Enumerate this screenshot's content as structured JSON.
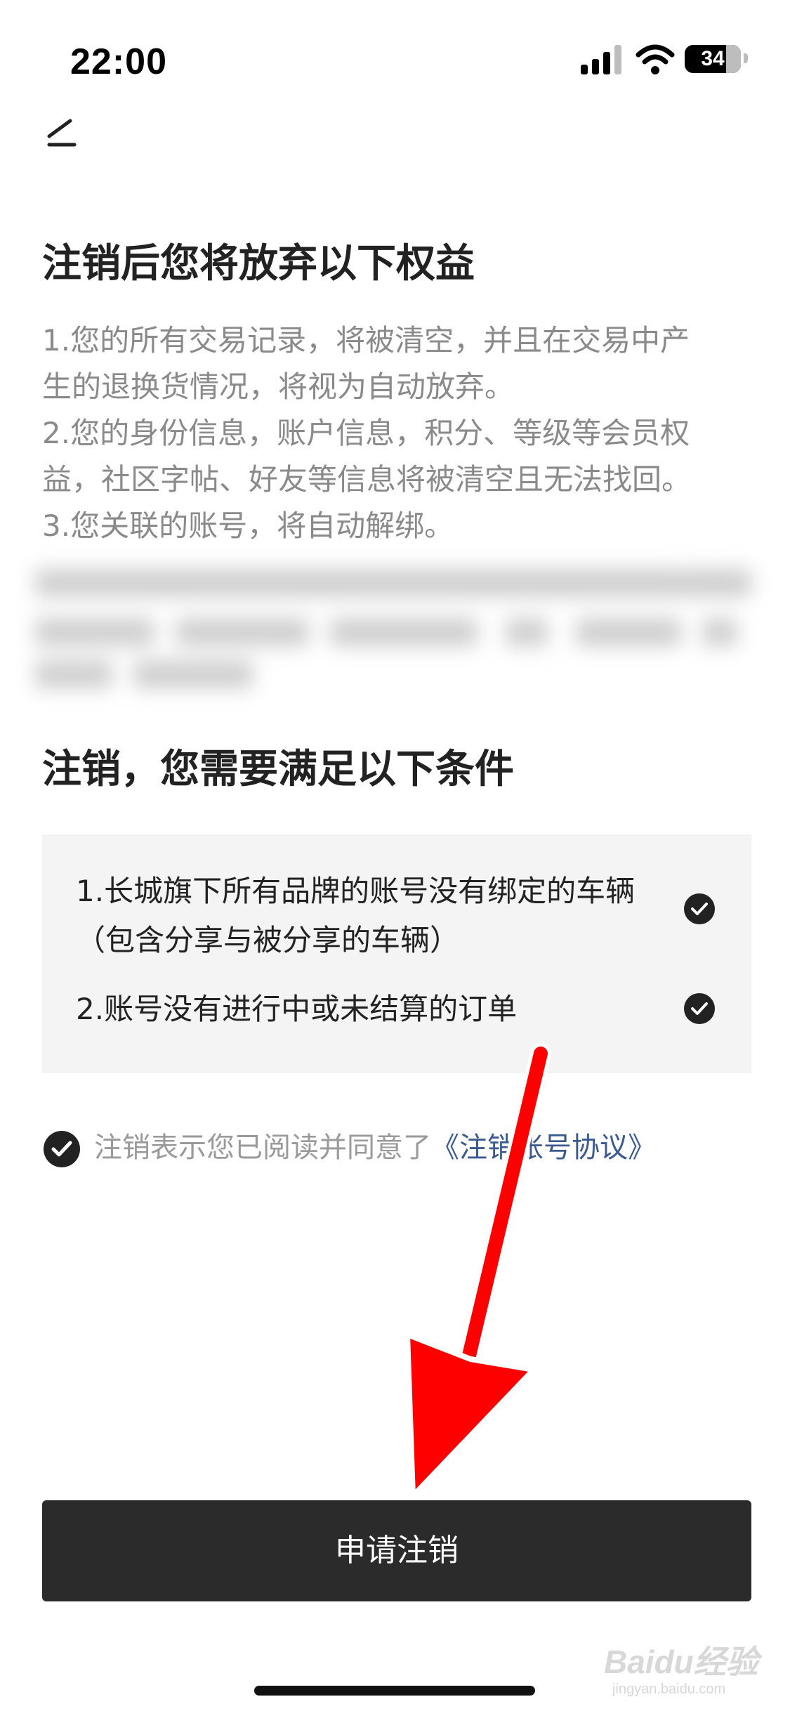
{
  "status_bar": {
    "time": "22:00",
    "battery": "34"
  },
  "page": {
    "section1_title": "注销后您将放弃以下权益",
    "section1_body": "1.您的所有交易记录，将被清空，并且在交易中产\n生的退换货情况，将视为自动放弃。\n2.您的身份信息，账户信息，积分、等级等会员权\n益，社区字帖、好友等信息将被清空且无法找回。\n3.您关联的账号，将自动解绑。",
    "section2_title": "注销，您需要满足以下条件",
    "conditions": [
      {
        "text": "1.长城旗下所有品牌的账号没有绑定的车辆（包含分享与被分享的车辆）",
        "checked": true
      },
      {
        "text": "2.账号没有进行中或未结算的订单",
        "checked": true
      }
    ],
    "agreement": {
      "prefix": "注销表示您已阅读并同意了",
      "link": "《注销账号协议》",
      "checked": true
    },
    "submit_button": "申请注销"
  },
  "icons": {
    "back": "back-arrow-icon",
    "check": "check-circle-icon",
    "signal": "signal-icon",
    "wifi": "wifi-icon",
    "battery": "battery-icon",
    "overlay": "red-arrow-annotation"
  },
  "colors": {
    "primary_button_bg": "#2b2b2b",
    "link": "#3b5a8e",
    "annotation_arrow": "#ff0000"
  },
  "watermark": {
    "brand": "Baidu经验",
    "url": "jingyan.baidu.com"
  }
}
